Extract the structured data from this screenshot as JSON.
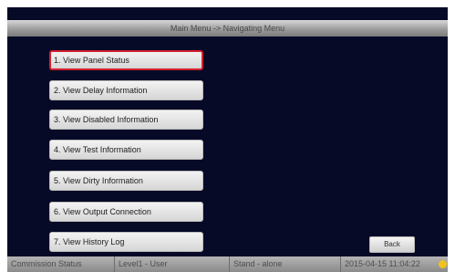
{
  "header": {
    "title": "Main Menu -> Navigating Menu"
  },
  "menu": {
    "items": [
      {
        "label": "1. View Panel Status"
      },
      {
        "label": "2. View Delay Information"
      },
      {
        "label": "3. View Disabled Information"
      },
      {
        "label": "4. View Test Information"
      },
      {
        "label": "5. View Dirty Information"
      },
      {
        "label": "6. View Output Connection"
      },
      {
        "label": "7. View History Log"
      }
    ],
    "selected_item": "1. View Panel Status"
  },
  "back_button": {
    "label": "Back"
  },
  "status_bar": {
    "mode": "Commission Status",
    "user_level": "Level1 - User",
    "network": "Stand - alone",
    "datetime": "2015-04-15 11:04:22",
    "indicator_icon": "status-indicator-icon"
  },
  "colors": {
    "background": "#070a26",
    "selection_border": "#d2202e",
    "status_indicator": "#f1c21b"
  }
}
